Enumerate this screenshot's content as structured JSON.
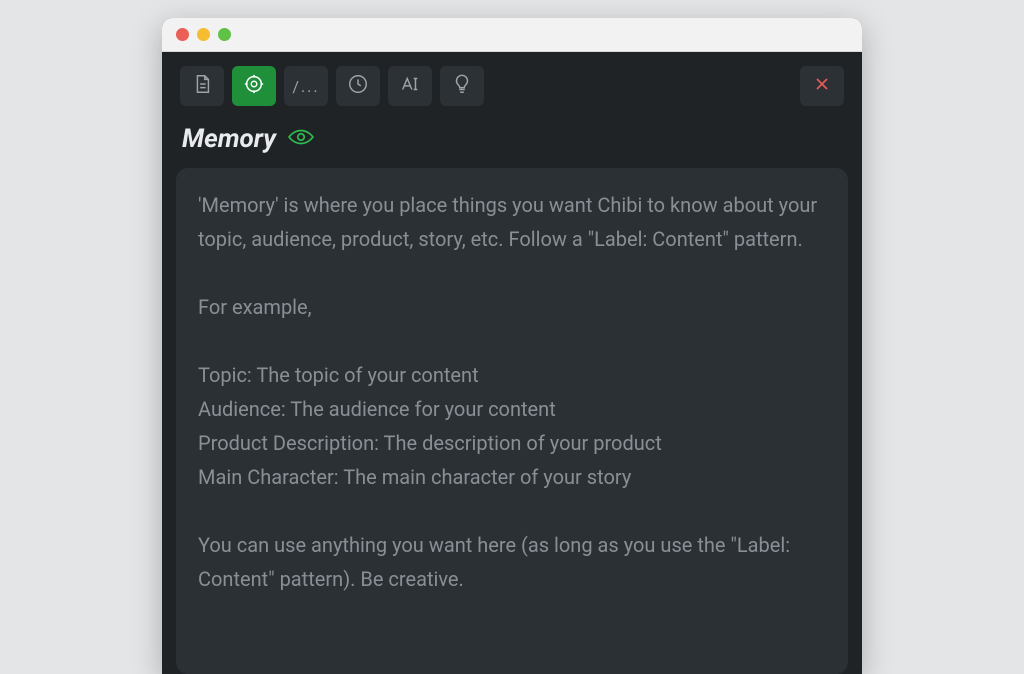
{
  "toolbar": {
    "tabs": [
      {
        "name": "document-tab",
        "icon": "document-icon",
        "active": false
      },
      {
        "name": "memory-tab",
        "icon": "target-icon",
        "active": true
      },
      {
        "name": "path-tab",
        "icon": "slash-dots-icon",
        "active": false
      },
      {
        "name": "history-tab",
        "icon": "clock-icon",
        "active": false
      },
      {
        "name": "typography-tab",
        "icon": "text-icon",
        "active": false
      },
      {
        "name": "lightbulb-tab",
        "icon": "lightbulb-icon",
        "active": false
      }
    ],
    "slash_label": "/..."
  },
  "section": {
    "title": "Memory",
    "visibility_on": true
  },
  "content": {
    "text": "'Memory' is where you place things you want Chibi to know about your topic, audience, product, story, etc. Follow a \"Label: Content\" pattern.\n\nFor example,\n\nTopic: The topic of your content\nAudience: The audience for your content\nProduct Description: The description of your product\nMain Character: The main character of your story\n\nYou can use anything you want here (as long as you use the \"Label: Content\" pattern). Be creative."
  }
}
